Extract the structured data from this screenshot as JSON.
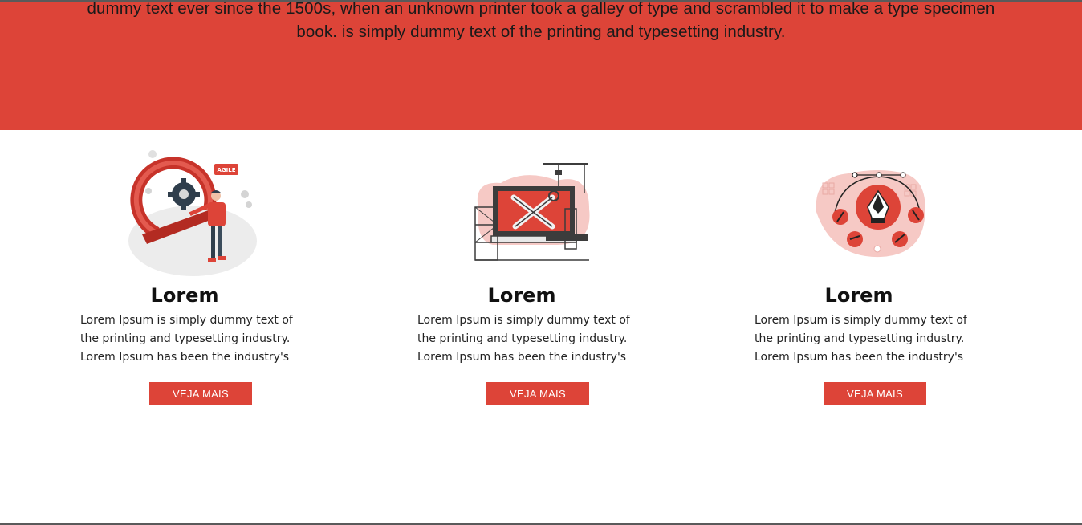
{
  "hero": {
    "text_line1": "dummy text ever since the 1500s, when an unknown printer took a galley of type and scrambled it to make a type specimen",
    "text_line2": "book. is simply dummy text of the printing and typesetting industry."
  },
  "cards": [
    {
      "illustration": "agile-gear-illustration",
      "badge": "AGILE",
      "title": "Lorem",
      "desc_line1": "Lorem Ipsum is simply dummy text of",
      "desc_line2": "the printing and typesetting industry.",
      "desc_line3": "Lorem Ipsum has been the industry's",
      "button": "VEJA MAIS"
    },
    {
      "illustration": "tools-construction-illustration",
      "title": "Lorem",
      "desc_line1": "Lorem Ipsum is simply dummy text of",
      "desc_line2": "the printing and typesetting industry.",
      "desc_line3": "Lorem Ipsum has been the industry's",
      "button": "VEJA MAIS"
    },
    {
      "illustration": "pen-tool-design-illustration",
      "title": "Lorem",
      "desc_line1": "Lorem Ipsum is simply dummy text of",
      "desc_line2": "the printing and typesetting industry.",
      "desc_line3": "Lorem Ipsum has been the industry's",
      "button": "VEJA MAIS"
    }
  ],
  "colors": {
    "accent": "#dd4438",
    "background": "#ffffff",
    "text": "#111111"
  }
}
